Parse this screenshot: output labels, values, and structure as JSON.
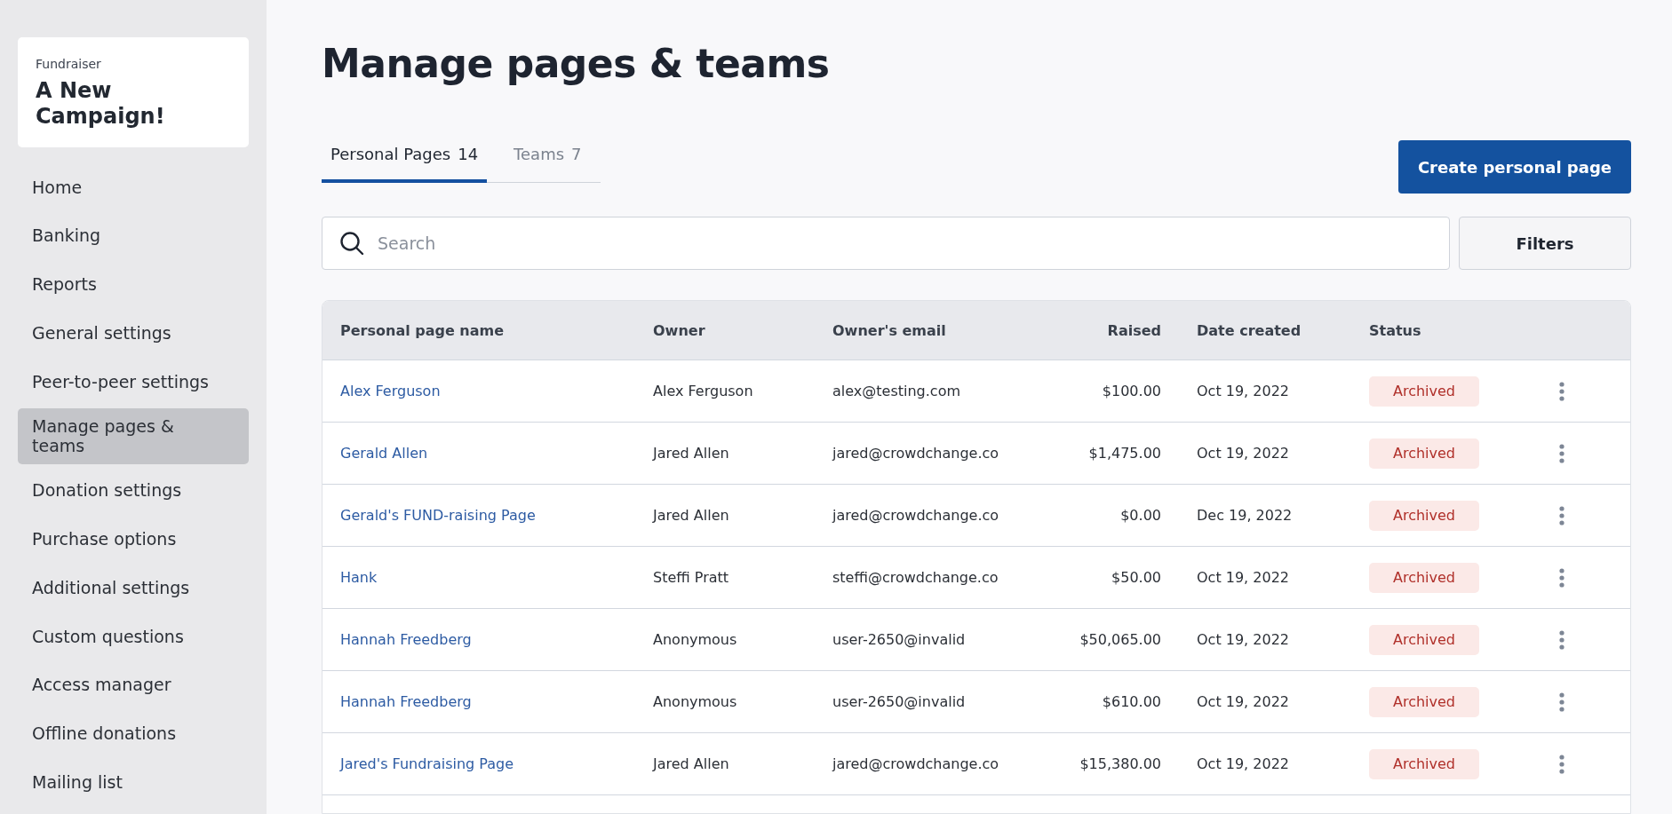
{
  "sidebar": {
    "fundraiser_label": "Fundraiser",
    "campaign_title": "A New Campaign!",
    "items": [
      {
        "label": "Home",
        "selected": false
      },
      {
        "label": "Banking",
        "selected": false
      },
      {
        "label": "Reports",
        "selected": false
      },
      {
        "label": "General settings",
        "selected": false
      },
      {
        "label": "Peer-to-peer settings",
        "selected": false
      },
      {
        "label": "Manage pages & teams",
        "selected": true
      },
      {
        "label": "Donation settings",
        "selected": false
      },
      {
        "label": "Purchase options",
        "selected": false
      },
      {
        "label": "Additional settings",
        "selected": false
      },
      {
        "label": "Custom questions",
        "selected": false
      },
      {
        "label": "Access manager",
        "selected": false
      },
      {
        "label": "Offline donations",
        "selected": false
      },
      {
        "label": "Mailing list",
        "selected": false
      }
    ]
  },
  "page_title": "Manage pages & teams",
  "tabs": [
    {
      "label": "Personal Pages",
      "count": "14",
      "selected": true
    },
    {
      "label": "Teams",
      "count": "7",
      "selected": false
    }
  ],
  "create_button": "Create personal page",
  "search": {
    "placeholder": "Search"
  },
  "filters_button": "Filters",
  "table": {
    "columns": [
      "Personal page name",
      "Owner",
      "Owner's email",
      "Raised",
      "Date created",
      "Status"
    ],
    "rows": [
      {
        "name": "Alex Ferguson",
        "owner": "Alex Ferguson",
        "email": "alex@testing.com",
        "raised": "$100.00",
        "date": "Oct 19, 2022",
        "status": "Archived"
      },
      {
        "name": "Gerald Allen",
        "owner": "Jared Allen",
        "email": "jared@crowdchange.co",
        "raised": "$1,475.00",
        "date": "Oct 19, 2022",
        "status": "Archived"
      },
      {
        "name": "Gerald's FUND-raising Page",
        "owner": "Jared Allen",
        "email": "jared@crowdchange.co",
        "raised": "$0.00",
        "date": "Dec 19, 2022",
        "status": "Archived"
      },
      {
        "name": "Hank",
        "owner": "Steffi Pratt",
        "email": "steffi@crowdchange.co",
        "raised": "$50.00",
        "date": "Oct 19, 2022",
        "status": "Archived"
      },
      {
        "name": "Hannah Freedberg",
        "owner": "Anonymous",
        "email": "user-2650@invalid",
        "raised": "$50,065.00",
        "date": "Oct 19, 2022",
        "status": "Archived"
      },
      {
        "name": "Hannah Freedberg",
        "owner": "Anonymous",
        "email": "user-2650@invalid",
        "raised": "$610.00",
        "date": "Oct 19, 2022",
        "status": "Archived"
      },
      {
        "name": "Jared's Fundraising Page",
        "owner": "Jared Allen",
        "email": "jared@crowdchange.co",
        "raised": "$15,380.00",
        "date": "Oct 19, 2022",
        "status": "Archived"
      }
    ]
  }
}
